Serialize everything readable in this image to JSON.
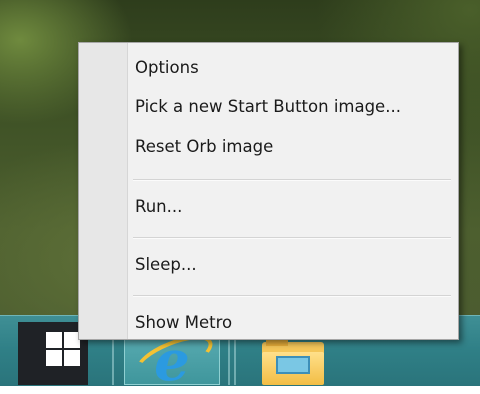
{
  "context_menu": {
    "items": [
      {
        "label": "Options"
      },
      {
        "label": "Pick a new Start Button image..."
      },
      {
        "label": "Reset Orb image"
      },
      {
        "label": "Run..."
      },
      {
        "label": "Sleep..."
      },
      {
        "label": "Show Metro"
      }
    ]
  },
  "taskbar": {
    "buttons": [
      {
        "icon": "windows-logo-icon"
      },
      {
        "icon": "internet-explorer-icon"
      },
      {
        "icon": "file-explorer-folder-icon"
      }
    ]
  },
  "colors": {
    "menu_bg": "#f1f1f1",
    "taskbar": "#2f7f86",
    "start_button": "#1f2226"
  }
}
